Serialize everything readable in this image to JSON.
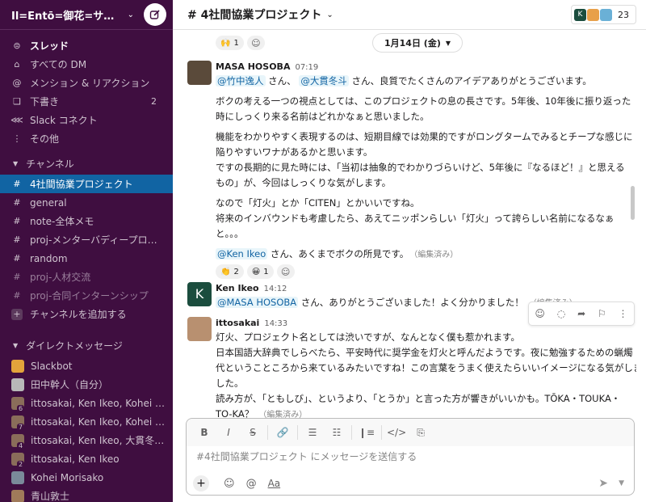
{
  "workspace": {
    "name": "Il=Entō=御花=サ…"
  },
  "nav": [
    {
      "label": "スレッド",
      "icon": "threads-icon",
      "glyph": "⊜",
      "bold": true
    },
    {
      "label": "すべての DM",
      "icon": "dm-icon",
      "glyph": "⌂"
    },
    {
      "label": "メンション & リアクション",
      "icon": "at-icon",
      "glyph": "@"
    },
    {
      "label": "下書き",
      "icon": "drafts-icon",
      "glyph": "❏",
      "count": "2"
    },
    {
      "label": "Slack コネクト",
      "icon": "connect-icon",
      "glyph": "⋘"
    },
    {
      "label": "その他",
      "icon": "more-icon",
      "glyph": "⋮"
    }
  ],
  "channels_section": {
    "label": "チャンネル"
  },
  "channels": [
    {
      "label": "4社間協業プロジェクト",
      "active": true
    },
    {
      "label": "general"
    },
    {
      "label": "note-全体メモ"
    },
    {
      "label": "proj-メンターバディープロ…"
    },
    {
      "label": "random"
    },
    {
      "label": "proj-人材交流",
      "dim": true
    },
    {
      "label": "proj-合同インターンシップ",
      "dim": true
    }
  ],
  "add_channel": "チャンネルを追加する",
  "dm_section": {
    "label": "ダイレクトメッセージ"
  },
  "dms": [
    {
      "label": "Slackbot",
      "color": "#e3a33b"
    },
    {
      "label": "田中幹人（自分）",
      "color": "#b8b8b8"
    },
    {
      "label": "ittosakai, Ken Ikeo, Kohei …",
      "color": "#8a6d5a",
      "badge": "6"
    },
    {
      "label": "ittosakai, Ken Ikeo, Kohei …",
      "color": "#8a6d5a",
      "badge": "7"
    },
    {
      "label": "ittosakai, Ken Ikeo, 大貫冬…",
      "color": "#8a6d5a",
      "badge": "4"
    },
    {
      "label": "ittosakai, Ken Ikeo",
      "color": "#8a6d5a",
      "badge": "2"
    },
    {
      "label": "Kohei Morisako",
      "color": "#7a8a9a"
    },
    {
      "label": "青山敦士",
      "color": "#a07a5a"
    }
  ],
  "channel": {
    "title": "# 4社間協業プロジェクト",
    "member_count": "23"
  },
  "date_divider": "1月14日 (金)",
  "top_reactions": [
    {
      "emoji": "🙌",
      "count": "1"
    }
  ],
  "messages": [
    {
      "author": "MASA HOSOBA",
      "time": "07:19",
      "avatar_color": "#5a4a3a",
      "m1": "@竹中逸人",
      "t1": " さん、 ",
      "m2": "@大貫冬斗",
      "t2": " さん、良質でたくさんのアイデアありがとうございます。",
      "lines": [
        [
          "ボクの考える一つの視点としては、このプロジェクトの息の長さです。5年後、10年後に振り返った",
          "時にしっくり来る名前はどれかなぁと思いました。"
        ],
        [
          "機能をわかりやすく表現するのは、短期目線では効果的ですがロングタームでみるとチープな感じに",
          "陥りやすいワナがあるかと思います。",
          "ですの長期的に見た時には、「当初は抽象的でわかりづらいけど、5年後に『なるほど！』と思える",
          "もの」が、今回はしっくりな気がします。"
        ],
        [
          "なので「灯火」とか「CITEN」とかいいですね。",
          "将来のインバウンドも考慮したら、あえてニッポンらしい「灯火」って誇らしい名前になるなぁ",
          "と。。。"
        ]
      ],
      "m3": "@Ken Ikeo",
      "t3": " さん、あくまでボクの所見です。",
      "edited": "（編集済み）",
      "reactions": [
        {
          "emoji": "👏",
          "count": "2"
        },
        {
          "emoji": "😀",
          "count": "1"
        }
      ]
    },
    {
      "author": "Ken Ikeo",
      "time": "14:12",
      "avatar_color": "#1b4d3e",
      "avatar_letter": "K",
      "m1": "@MASA HOSOBA",
      "t1": " さん、ありがとうございました！よく分かりました！",
      "edited": "（編集済み）"
    },
    {
      "author": "ittosakai",
      "time": "14:33",
      "avatar_color": "#b89070",
      "lines": [
        "灯火、プロジェクト名としては渋いですが、なんとなく僕も惹かれます。",
        "日本国語大辞典でしらべたら、平安時代に奨学金を灯火と呼んだようです。夜に勉強するための蝋燭",
        "代ということころから来ているみたいですね！この言葉をうまく使えたらいいイメージになる気がしま",
        "した。",
        "読み方が、「ともしび」、というより、「とうか」と言った方が響きがいいかも。TŌKA・TOUKA・",
        "TO-KA？"
      ],
      "edited": "（編集済み）"
    }
  ],
  "composer": {
    "placeholder": "#4社間協業プロジェクト にメッセージを送信する"
  },
  "colors": {
    "sidebar": "#3f0e40",
    "active": "#1164a3",
    "mention_bg": "#e8f5fa",
    "mention_fg": "#1264a3"
  }
}
